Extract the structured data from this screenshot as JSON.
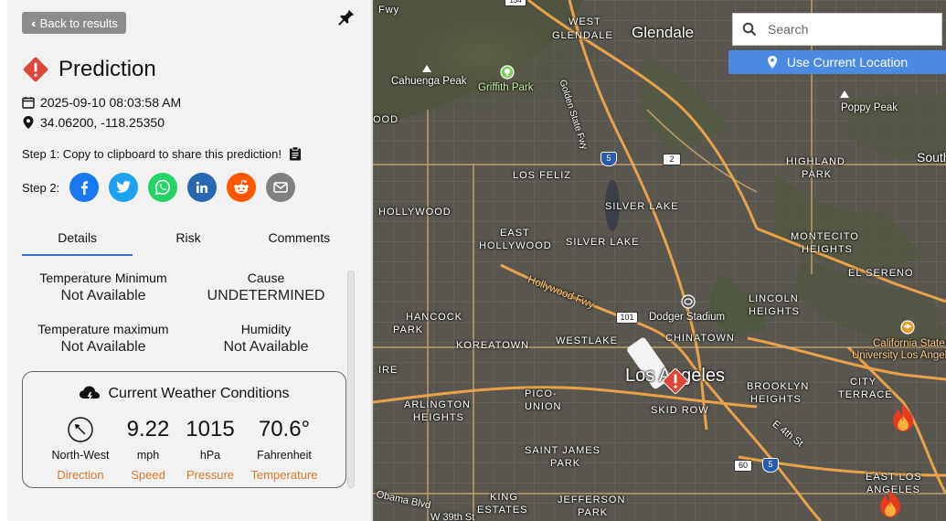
{
  "nav": {
    "back_label": "Back to results"
  },
  "prediction": {
    "title": "Prediction",
    "datetime": "2025-09-10 08:03:58 AM",
    "coords": "34.06200, -118.25350"
  },
  "share": {
    "step1": "Step 1: Copy to clipboard to share this prediction!",
    "step2": "Step 2:",
    "buttons": [
      {
        "name": "facebook",
        "color": "#1877f2"
      },
      {
        "name": "twitter",
        "color": "#1da1f2"
      },
      {
        "name": "whatsapp",
        "color": "#25d366"
      },
      {
        "name": "linkedin",
        "color": "#2867b2"
      },
      {
        "name": "reddit",
        "color": "#ff5700"
      },
      {
        "name": "email",
        "color": "#808080"
      }
    ]
  },
  "tabs": [
    "Details",
    "Risk",
    "Comments"
  ],
  "details": {
    "temp_min_label": "Temperature Minimum",
    "temp_min_value": "Not Available",
    "cause_label": "Cause",
    "cause_value": "UNDETERMINED",
    "temp_max_label": "Temperature maximum",
    "temp_max_value": "Not Available",
    "humidity_label": "Humidity",
    "humidity_value": "Not Available"
  },
  "weather": {
    "title": "Current Weather Conditions",
    "direction_value": "North-West",
    "direction_label": "Direction",
    "speed_value": "9.22",
    "speed_unit": "mph",
    "speed_label": "Speed",
    "pressure_value": "1015",
    "pressure_unit": "hPa",
    "pressure_label": "Pressure",
    "temp_value": "70.6°",
    "temp_unit": "Fahrenheit",
    "temp_label": "Temperature",
    "accent_color": "#e0762d"
  },
  "map": {
    "search_placeholder": "Search",
    "location_button": "Use Current Location",
    "labels": {
      "glendale": "Glendale",
      "west_glendale_1": "WEST",
      "west_glendale_2": "GLENDALE",
      "cahuenga": "Cahuenga Peak",
      "griffith": "Griffith Park",
      "golden_state": "Golden State Fwy",
      "los_feliz": "LOS FELIZ",
      "hollywood": "HOLLYWOOD",
      "silver_lake_res": "SILVER LAKE",
      "east_hollywood_1": "EAST",
      "east_hollywood_2": "HOLLYWOOD",
      "silver_lake": "SILVER LAKE",
      "hollywood_fwy": "Hollywood Fwy",
      "hancock_1": "HANCOCK",
      "hancock_2": "PARK",
      "koreatown": "KOREATOWN",
      "westlake": "WESTLAKE",
      "dodger": "Dodger Stadium",
      "chinatown": "CHINATOWN",
      "los_angeles": "Los Angeles",
      "highland_1": "HIGHLAND",
      "highland_2": "PARK",
      "montecito_1": "MONTECITO",
      "montecito_2": "HEIGHTS",
      "el_sereno": "EL SERENO",
      "lincoln_1": "LINCOLN",
      "lincoln_2": "HEIGHTS",
      "poppy": "Poppy Peak",
      "south": "South",
      "calstate_1": "California State",
      "calstate_2": "University Los Angeles",
      "city_terrace_1": "CITY",
      "city_terrace_2": "TERRACE",
      "arlington_1": "ARLINGTON",
      "arlington_2": "HEIGHTS",
      "pico_1": "PICO-",
      "pico_2": "UNION",
      "skid_row": "SKID ROW",
      "brooklyn_1": "BROOKLYN",
      "brooklyn_2": "HEIGHTS",
      "e4th": "E 4th St",
      "saint_james_1": "SAINT JAMES",
      "saint_james_2": "PARK",
      "east_la_1": "EAST LOS",
      "east_la_2": "ANGELES",
      "obama": "Obama Blvd",
      "king_1": "KING",
      "king_2": "ESTATES",
      "jefferson_1": "JEFFERSON",
      "jefferson_2": "PARK",
      "w39th": "W 39th St",
      "ood": "OOD",
      "ire": "IRE",
      "fwy": "Fwy"
    },
    "shields": {
      "i5_top": "5",
      "r2": "2",
      "r101": "101",
      "r60": "60",
      "i5_bottom": "5",
      "r134": "134"
    }
  }
}
